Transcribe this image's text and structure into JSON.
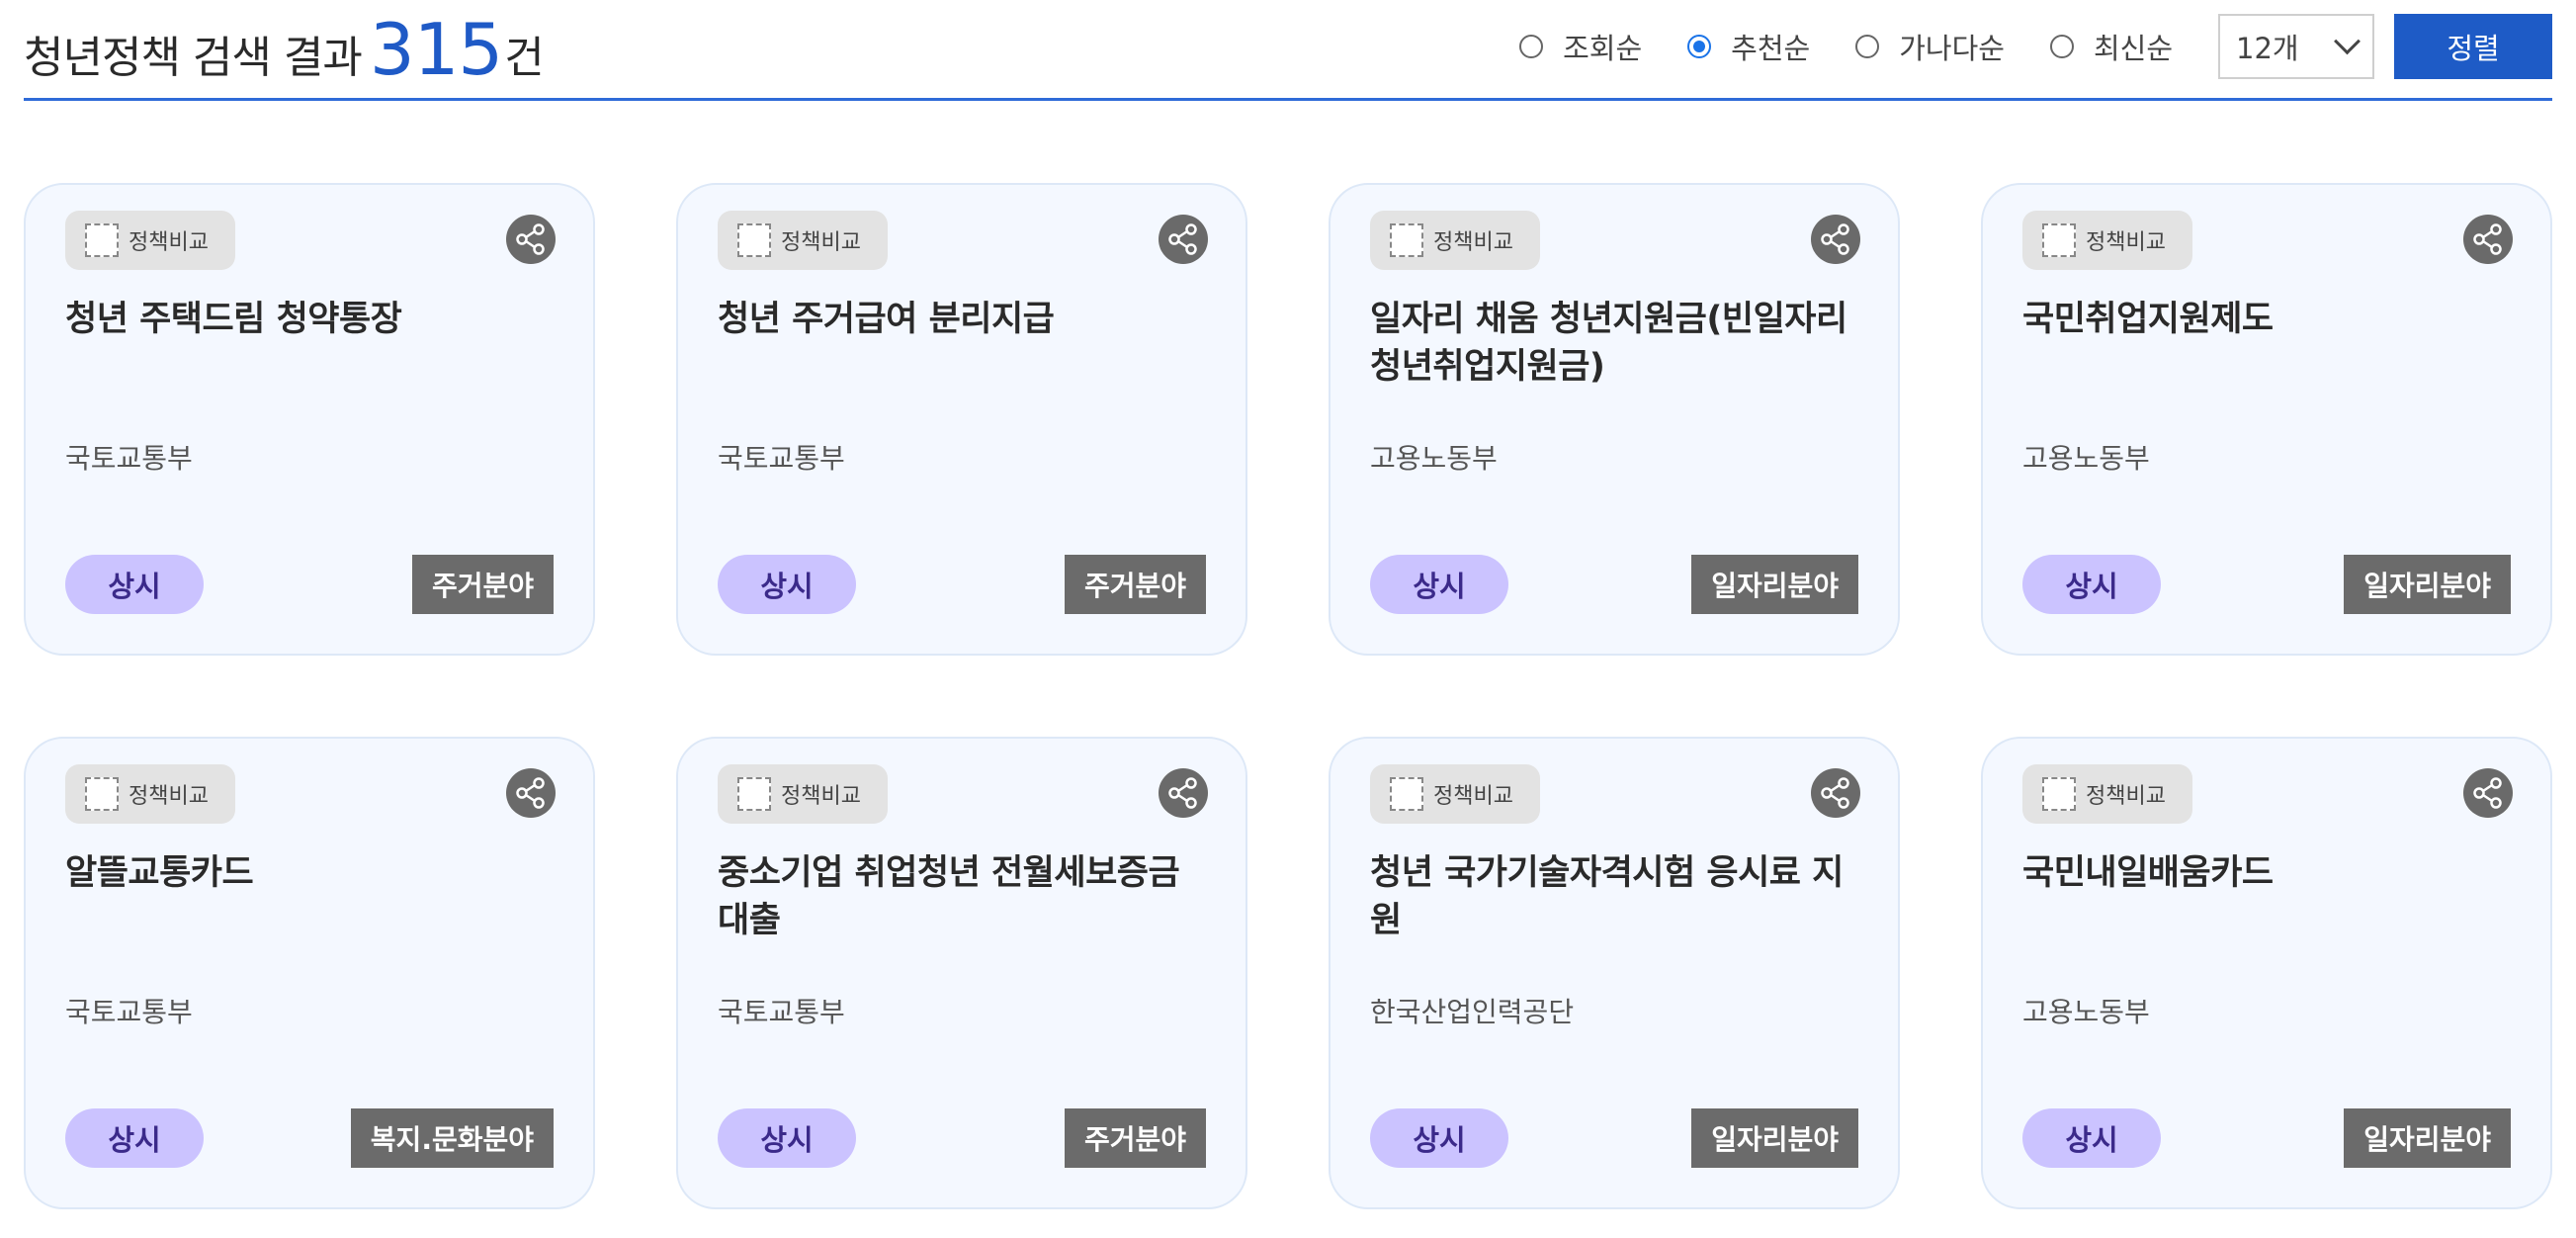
{
  "header": {
    "title_prefix": "청년정책 검색 결과",
    "count": "315",
    "count_suffix": "건"
  },
  "sort": {
    "options": [
      {
        "label": "조회순",
        "selected": false
      },
      {
        "label": "추천순",
        "selected": true
      },
      {
        "label": "가나다순",
        "selected": false
      },
      {
        "label": "최신순",
        "selected": false
      }
    ],
    "page_size": "12개",
    "sort_button": "정렬",
    "accent_color": "#1e5bc6"
  },
  "cards": [
    {
      "compare_label": "정책비교",
      "title": "청년 주택드림 청약통장",
      "agency": "국토교통부",
      "status": "상시",
      "category": "주거분야"
    },
    {
      "compare_label": "정책비교",
      "title": "청년 주거급여 분리지급",
      "agency": "국토교통부",
      "status": "상시",
      "category": "주거분야"
    },
    {
      "compare_label": "정책비교",
      "title": "일자리 채움 청년지원금(빈일자리 청년취업지원금)",
      "agency": "고용노동부",
      "status": "상시",
      "category": "일자리분야"
    },
    {
      "compare_label": "정책비교",
      "title": "국민취업지원제도",
      "agency": "고용노동부",
      "status": "상시",
      "category": "일자리분야"
    },
    {
      "compare_label": "정책비교",
      "title": "알뜰교통카드",
      "agency": "국토교통부",
      "status": "상시",
      "category": "복지.문화분야"
    },
    {
      "compare_label": "정책비교",
      "title": "중소기업 취업청년 전월세보증금 대출",
      "agency": "국토교통부",
      "status": "상시",
      "category": "주거분야"
    },
    {
      "compare_label": "정책비교",
      "title": "청년 국가기술자격시험 응시료 지원",
      "agency": "한국산업인력공단",
      "status": "상시",
      "category": "일자리분야"
    },
    {
      "compare_label": "정책비교",
      "title": "국민내일배움카드",
      "agency": "고용노동부",
      "status": "상시",
      "category": "일자리분야"
    }
  ]
}
